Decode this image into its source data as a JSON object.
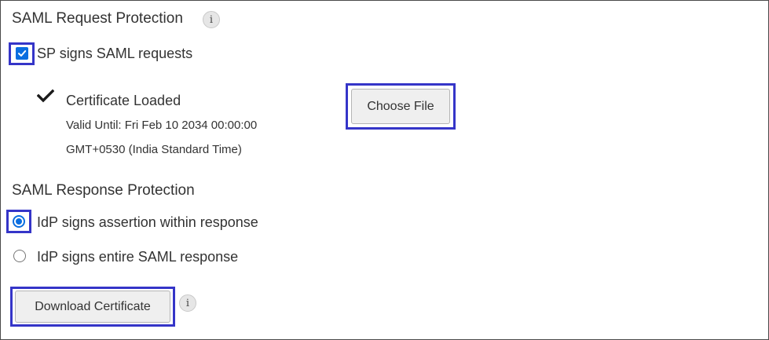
{
  "request_protection": {
    "title": "SAML Request Protection",
    "info_glyph": "i",
    "sp_signs": {
      "label": "SP signs SAML requests",
      "checked": true
    }
  },
  "certificate": {
    "status_icon": "checkmark-icon",
    "title": "Certificate Loaded",
    "valid_until": "Valid Until: Fri Feb 10 2034 00:00:00",
    "timezone": "GMT+0530 (India Standard Time)",
    "choose_file_label": "Choose File"
  },
  "response_protection": {
    "title": "SAML Response Protection",
    "options": [
      {
        "label": "IdP signs assertion within response",
        "selected": true
      },
      {
        "label": "IdP signs entire SAML response",
        "selected": false
      }
    ]
  },
  "download": {
    "label": "Download Certificate",
    "info_glyph": "i"
  },
  "colors": {
    "highlight": "#3535c8",
    "control_accent": "#0a6ee0",
    "text": "#333333"
  }
}
